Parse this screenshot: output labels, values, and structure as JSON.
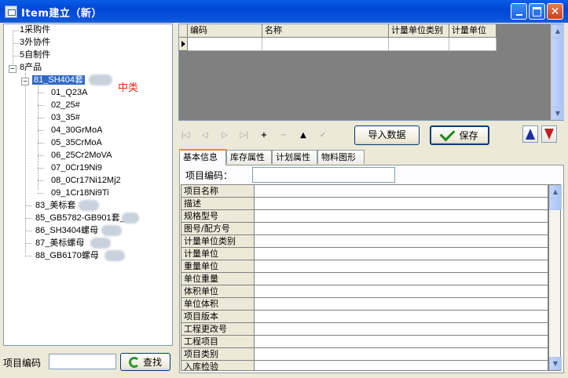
{
  "window": {
    "title": "Item建立（新）"
  },
  "tree": {
    "nodes": [
      {
        "label": "1采购件"
      },
      {
        "label": "3外协件"
      },
      {
        "label": "5自制件"
      },
      {
        "label": "8产品"
      },
      {
        "label": "81_SH404套"
      },
      {
        "label": "01_Q23A"
      },
      {
        "label": "02_25#"
      },
      {
        "label": "03_35#"
      },
      {
        "label": "04_30GrMoA"
      },
      {
        "label": "05_35CrMoA"
      },
      {
        "label": "06_25Cr2MoVA"
      },
      {
        "label": "07_0Cr19Ni9"
      },
      {
        "label": "08_0Cr17Ni12Mj2"
      },
      {
        "label": "09_1Cr18Ni9Ti"
      },
      {
        "label": "83_美标套"
      },
      {
        "label": "85_GB5782-GB901套_"
      },
      {
        "label": "86_SH3404螺母"
      },
      {
        "label": "87_美标螺母"
      },
      {
        "label": "88_GB6170螺母"
      }
    ],
    "annotation": "中类"
  },
  "search": {
    "label": "项目编码",
    "value": "",
    "button": "查找"
  },
  "grid": {
    "columns": [
      "编码",
      "名称",
      "计量单位类别",
      "计量单位"
    ]
  },
  "toolbar": {
    "nav": [
      "|◁",
      "◁",
      "▷",
      "▷|",
      "+",
      "−",
      "▲",
      "✓"
    ],
    "import_label": "导入数据",
    "save_label": "保存"
  },
  "tabs": [
    {
      "label": "基本信息",
      "active": true
    },
    {
      "label": "库存属性",
      "active": false
    },
    {
      "label": "计划属性",
      "active": false
    },
    {
      "label": "物料图形",
      "active": false
    }
  ],
  "form": {
    "code_label": "项目编码：",
    "code_value": "",
    "properties": [
      "项目名称",
      "描述",
      "规格型号",
      "图号/配方号",
      "计量单位类别",
      "计量单位",
      "重量单位",
      "单位重量",
      "体积单位",
      "单位体积",
      "项目版本",
      "工程更改号",
      "工程项目",
      "项目类别",
      "入库检验"
    ]
  }
}
